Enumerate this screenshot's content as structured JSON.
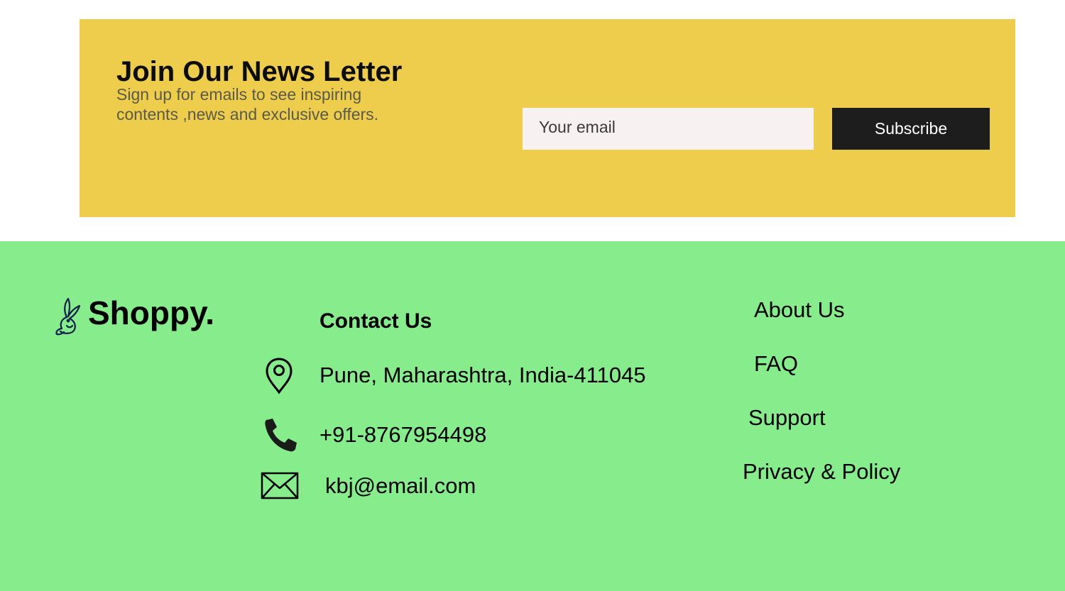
{
  "newsletter": {
    "title": "Join Our News Letter",
    "subtitle": "Sign up for emails to see inspiring contents ,news and exclusive offers.",
    "email_placeholder": "Your email",
    "email_value": "",
    "subscribe_label": "Subscribe",
    "background_color": "#eecc4c",
    "button_color": "#1e1d1d"
  },
  "footer": {
    "background_color": "#87ed8c",
    "brand": {
      "name": "Shoppy.",
      "icon": "rabbit-logo-icon"
    },
    "contact": {
      "heading": "Contact Us",
      "items": [
        {
          "icon": "location-pin-icon",
          "text": "Pune, Maharashtra, India-411045"
        },
        {
          "icon": "phone-icon",
          "text": "+91-8767954498"
        },
        {
          "icon": "envelope-icon",
          "text": "kbj@email.com"
        }
      ]
    },
    "links": [
      {
        "label": "About Us"
      },
      {
        "label": "FAQ"
      },
      {
        "label": "Support"
      },
      {
        "label": "Privacy & Policy"
      }
    ]
  }
}
